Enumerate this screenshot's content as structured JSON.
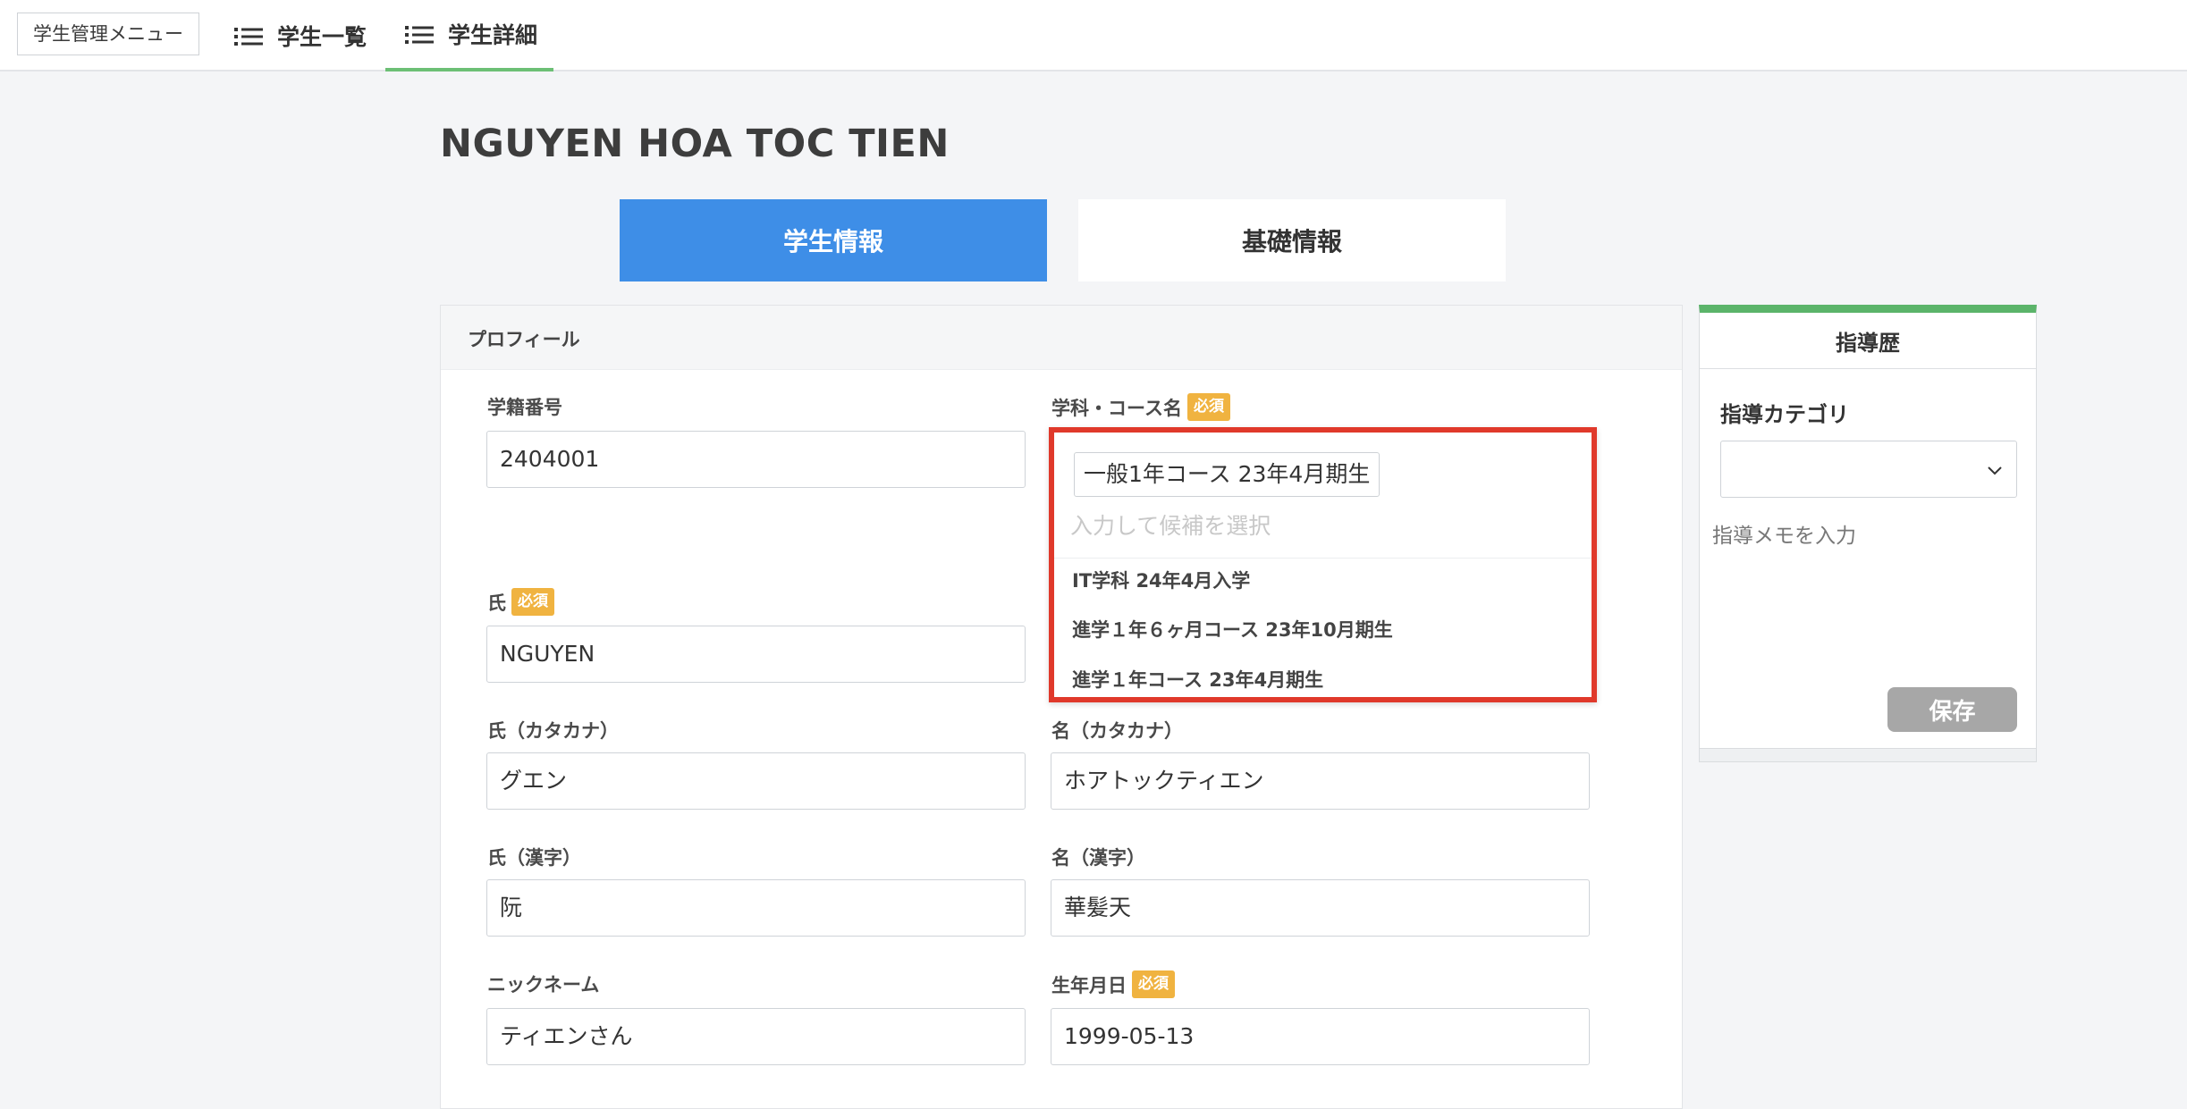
{
  "topnav": {
    "menu_label": "学生管理メニュー",
    "tabs": [
      {
        "label": "学生一覧",
        "icon": "list-icon",
        "active": false
      },
      {
        "label": "学生詳細",
        "icon": "list-icon",
        "active": true
      }
    ],
    "active_color": "#6cbf75"
  },
  "page": {
    "title": "NGUYEN HOA TOC TIEN"
  },
  "section_tabs": [
    {
      "label": "学生情報",
      "active": true,
      "color": "#3e8ee7"
    },
    {
      "label": "基礎情報",
      "active": false
    }
  ],
  "profile": {
    "header": "プロフィール",
    "required_label": "必須",
    "required_color": "#f0b340",
    "student_no": {
      "label": "学籍番号",
      "value": "2404001"
    },
    "course": {
      "label": "学科・コース名",
      "selected": "一般1年コース 23年4月期生",
      "search_placeholder": "入力して候補を選択",
      "options": [
        "IT学科 24年4月入学",
        "進学１年６ヶ月コース 23年10月期生",
        "進学１年コース 23年4月期生"
      ],
      "highlight_color": "#e0392b"
    },
    "last_name": {
      "label": "氏",
      "value": "NGUYEN"
    },
    "last_name_kana": {
      "label": "氏（カタカナ）",
      "value": "グエン"
    },
    "first_name_kana": {
      "label": "名（カタカナ）",
      "value": "ホアトックティエン"
    },
    "last_name_kanji": {
      "label": "氏（漢字）",
      "value": "阮"
    },
    "first_name_kanji": {
      "label": "名（漢字）",
      "value": "華髪天"
    },
    "nickname": {
      "label": "ニックネーム",
      "value": "ティエンさん"
    },
    "birthday": {
      "label": "生年月日",
      "value": "1999-05-13"
    }
  },
  "guidance": {
    "title": "指導歴",
    "category_label": "指導カテゴリ",
    "category_value": "",
    "memo_placeholder": "指導メモを入力",
    "save_label": "保存",
    "accent_color": "#5bb46a"
  }
}
